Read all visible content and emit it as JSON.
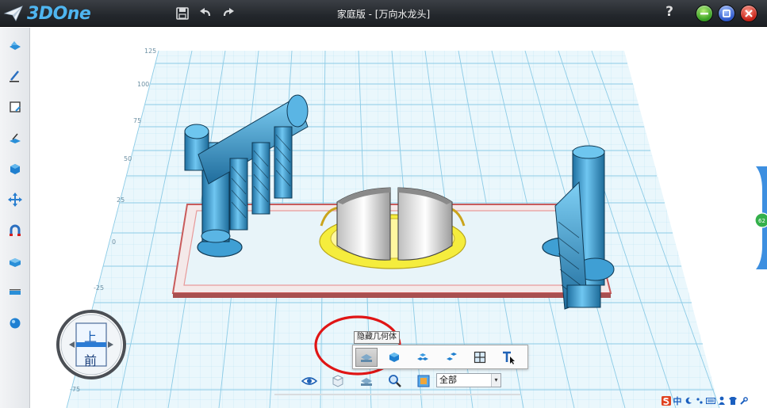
{
  "app": {
    "logo_text": "3DOne",
    "window_title": "家庭版 - [万向水龙头]",
    "help_label": "?"
  },
  "colors": {
    "titlebar": "#2a2e33",
    "logo": "#4fb6f0",
    "grid_line": "#7fc7e6",
    "grid_bg": "#eaf7fc",
    "model_blue": "#4aa8d8",
    "ring_yellow": "#f0e23a",
    "highlight_red": "#e01515"
  },
  "titlebar_icons": [
    "save-icon",
    "undo-icon",
    "redo-icon"
  ],
  "left_toolbar": [
    "basic-solid-icon",
    "sketch-icon",
    "sketch-edit-icon",
    "feature-icon",
    "special-feature-icon",
    "basic-edit-icon",
    "combine-icon",
    "auto-snap-icon",
    "distance-measure-icon",
    "material-render-icon"
  ],
  "grid_labels": {
    "y_axis": [
      "125",
      "100",
      "75",
      "50",
      "25",
      "0",
      "-25",
      "-75"
    ]
  },
  "tooltip": {
    "text": "隐藏几何体"
  },
  "popup_toolbar": {
    "items": [
      "hide-geometry-icon",
      "show-geometry-icon",
      "show-all-icon",
      "hide-selected-icon",
      "grid-icon",
      "text-icon"
    ]
  },
  "bottom_toolbar": {
    "items": [
      "display-icon",
      "view-icon",
      "hide-geometry-icon",
      "zoom-icon",
      "render-mode-icon"
    ],
    "filter_select": {
      "value": "全部"
    }
  },
  "view_cube": {
    "top_label": "上",
    "front_label": "前"
  },
  "right_tab": {
    "badge": "62"
  },
  "tray": {
    "ime_label": "中"
  }
}
